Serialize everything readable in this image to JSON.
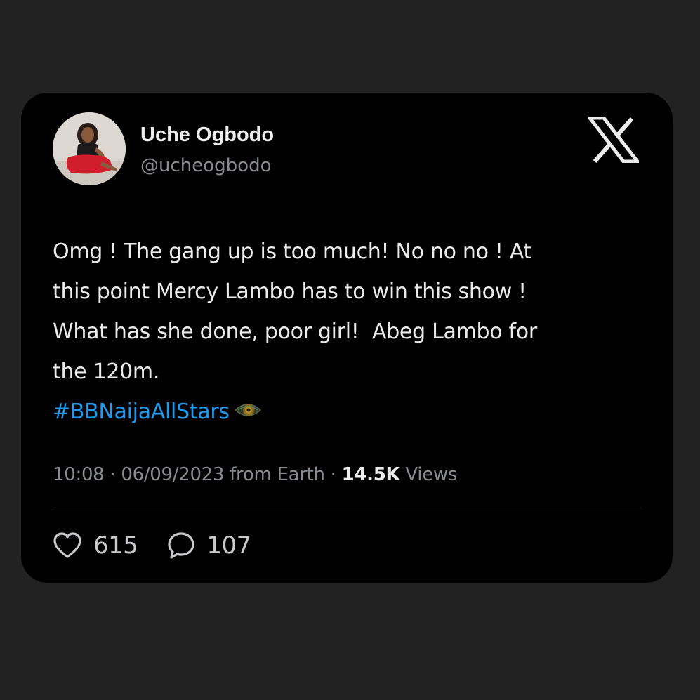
{
  "tweet": {
    "author": {
      "display_name": "Uche Ogbodo",
      "handle": "@ucheogbodo",
      "avatar": "profile-photo"
    },
    "platform_icon": "x-logo-icon",
    "text_lines": [
      "Omg ! The gang up is too much! No no no ! At",
      "this point Mercy Lambo has to win this show !",
      "What has she done, poor girl!  Abeg Lambo for",
      "the 120m."
    ],
    "hashtag": "#BBNaijaAllStars",
    "hashtag_emoji": "eye-emoji",
    "meta": {
      "time": "10:08",
      "separator": " · ",
      "date": "06/09/2023",
      "source": " from Earth",
      "views_count": "14.5K",
      "views_label": " Views"
    },
    "actions": {
      "likes": "615",
      "replies": "107"
    }
  },
  "colors": {
    "page_background": "#222222",
    "card_background": "#000000",
    "primary_text": "#ececec",
    "secondary_text": "#8a8d90",
    "hashtag": "#1d9bf0"
  }
}
